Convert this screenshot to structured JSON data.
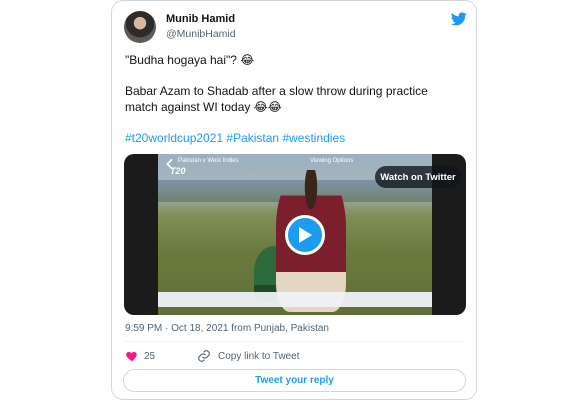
{
  "author": {
    "display_name": "Munib Hamid",
    "handle": "@MunibHamid"
  },
  "icons": {
    "brand": "twitter-bird-icon",
    "play": "play-icon",
    "like": "heart-icon",
    "copy": "link-icon",
    "back": "back-arrow-icon"
  },
  "tweet": {
    "lines": [
      "\"Budha hogaya hai\"? 😂",
      "Babar Azam to Shadab after a slow throw during practice",
      "match against WI today 😂😂"
    ],
    "hashtags": "#t20worldcup2021 #Pakistan #westindies"
  },
  "video": {
    "match_label": "Pakistan v West Indies",
    "viewing_label": "Viewing Options",
    "logo_text": "T20",
    "watch_label": "Watch on Twitter"
  },
  "meta": {
    "timestamp": "9:59 PM · Oct 18, 2021 from Punjab, Pakistan"
  },
  "actions": {
    "like_count": "25",
    "copy_link_label": "Copy link to Tweet",
    "reply_label": "Tweet your reply"
  },
  "colors": {
    "accent": "#1d9bf0",
    "text": "#0f1419",
    "muted": "#536471",
    "border": "#cfd9de",
    "heart": "#f91880"
  }
}
